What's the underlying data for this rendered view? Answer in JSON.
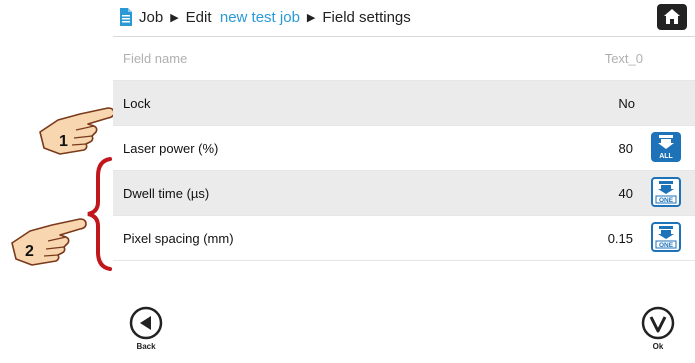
{
  "breadcrumb": {
    "job": "Job",
    "edit": "Edit",
    "job_name": "new test job",
    "page": "Field settings"
  },
  "rows": [
    {
      "label": "Field name",
      "value": "Text_0"
    },
    {
      "label": "Lock",
      "value": "No"
    },
    {
      "label": "Laser power (%)",
      "value": "80",
      "apply": "ALL"
    },
    {
      "label": "Dwell time (µs)",
      "value": "40",
      "apply": "ONE"
    },
    {
      "label": "Pixel spacing (mm)",
      "value": "0.15",
      "apply": "ONE"
    }
  ],
  "footer": {
    "back_label": "Back",
    "ok_label": "Ok"
  },
  "callouts": {
    "first": "1",
    "second": "2"
  },
  "colors": {
    "accent": "#2a9ad6",
    "button_blue": "#1e73b8",
    "callout_red": "#c0161c",
    "hand_fill": "#f7d6b0"
  },
  "icons": {
    "document": "document-icon",
    "home": "home-icon",
    "back": "back-arrow-icon",
    "ok": "checkmark-icon"
  }
}
